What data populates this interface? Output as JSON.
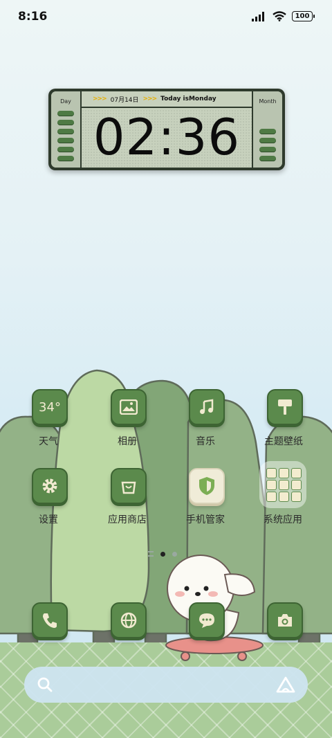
{
  "status_bar": {
    "time": "8:16",
    "battery": "100"
  },
  "clock_widget": {
    "day_label": "Day",
    "month_label": "Month",
    "date": "07月14日",
    "weekday_text": "Today isMonday",
    "time": "02:36"
  },
  "apps": {
    "weather": {
      "label": "天气",
      "value": "34°"
    },
    "gallery": {
      "label": "相册"
    },
    "music": {
      "label": "音乐"
    },
    "themes": {
      "label": "主题壁纸"
    },
    "settings": {
      "label": "设置"
    },
    "app_store": {
      "label": "应用商店"
    },
    "security": {
      "label": "手机管家"
    },
    "system_folder": {
      "label": "系统应用"
    }
  },
  "dock": [
    "phone-icon",
    "browser-icon",
    "messages-icon",
    "camera-icon"
  ],
  "colors": {
    "icon_green": "#5b8a4c",
    "icon_cream": "#f1ead0",
    "tree_light": "#bcd9a4",
    "tree_dark": "#93b287"
  }
}
